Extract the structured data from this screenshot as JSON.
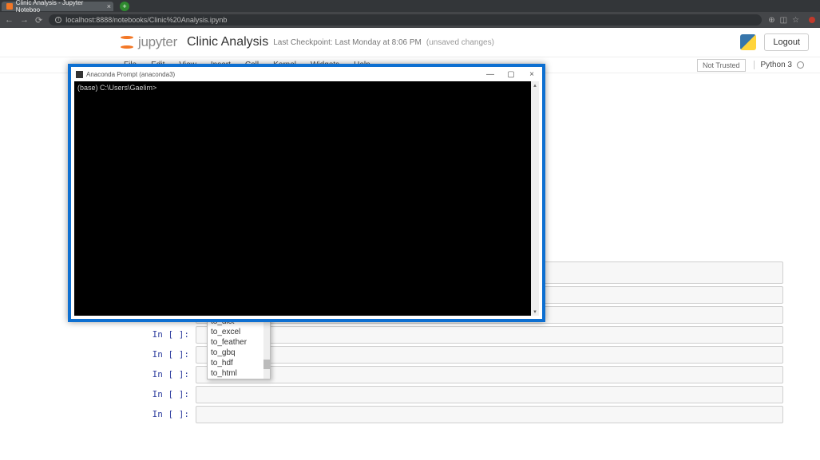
{
  "browser": {
    "tab_title": "Clinic Analysis - Jupyter Noteboo",
    "url": "localhost:8888/notebooks/Clinic%20Analysis.ipynb"
  },
  "jupyter": {
    "logo_text": "jupyter",
    "title": "Clinic Analysis",
    "checkpoint": "Last Checkpoint: Last Monday at 8:06 PM",
    "unsaved": "(unsaved changes)",
    "logout": "Logout",
    "trust": "Not Trusted",
    "kernel": "Python 3",
    "menu": [
      "File",
      "Edit",
      "View",
      "Insert",
      "Cell",
      "Kernel",
      "Widgets",
      "Help"
    ]
  },
  "terminal": {
    "title": "Anaconda Prompt (anaconda3)",
    "prompt_line": "(base) C:\\Users\\Gaelim>"
  },
  "cells": {
    "prompt": "In [ ]:"
  },
  "autocomplete": {
    "items": [
      "to_dict",
      "to_excel",
      "to_feather",
      "to_gbq",
      "to_hdf",
      "to_html"
    ]
  }
}
